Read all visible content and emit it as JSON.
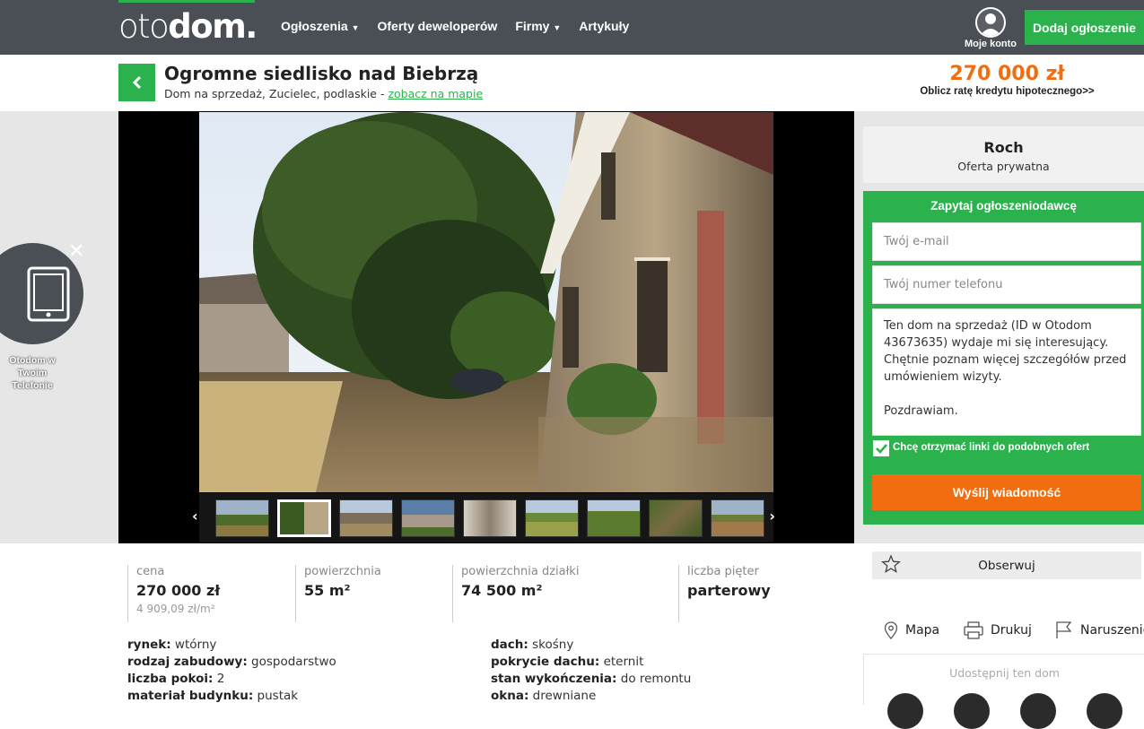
{
  "nav": {
    "logo_light": "oto",
    "logo_bold": "dom.",
    "menu": [
      {
        "label": "Ogłoszenia",
        "caret": true
      },
      {
        "label": "Oferty deweloperów",
        "caret": false
      },
      {
        "label": "Firmy",
        "caret": true
      },
      {
        "label": "Artykuły",
        "caret": false
      }
    ],
    "account_label": "Moje konto",
    "add_button": "Dodaj ogłoszenie"
  },
  "listing": {
    "title": "Ogromne siedlisko nad Biebrzą",
    "subtitle": "Dom na sprzedaż, Zucielec, podlaskie - ",
    "map_link": "zobacz na mapie",
    "price": "270 000 zł",
    "calc_link": "Oblicz ratę kredytu hipotecznego>>"
  },
  "gallery": {
    "thumb_count": 9,
    "active_thumb": 2
  },
  "promo": {
    "text": "Otodom w Twoim Telefonie",
    "close": "✕"
  },
  "seller": {
    "name": "Roch",
    "type": "Oferta prywatna"
  },
  "contact": {
    "title": "Zapytaj ogłoszeniodawcę",
    "email_placeholder": "Twój e-mail",
    "phone_placeholder": "Twój numer telefonu",
    "message": "Ten dom na sprzedaż (ID w Otodom 43673635) wydaje mi się interesujący. Chętnie poznam więcej szczegółów przed umówieniem wizyty.\n\nPozdrawiam.",
    "checkbox_label": "Chcę otrzymać linki do podobnych ofert",
    "checked": true,
    "send_button": "Wyślij wiadomość"
  },
  "stats": [
    {
      "label": "cena",
      "value": "270 000 zł",
      "sub": "4 909,09 zł/m²"
    },
    {
      "label": "powierzchnia",
      "value": "55 m²",
      "sub": ""
    },
    {
      "label": "powierzchnia działki",
      "value": "74 500 m²",
      "sub": ""
    },
    {
      "label": "liczba pięter",
      "value": "parterowy",
      "sub": ""
    }
  ],
  "details_left": [
    {
      "key": "rynek:",
      "value": "wtórny"
    },
    {
      "key": "rodzaj zabudowy:",
      "value": "gospodarstwo"
    },
    {
      "key": "liczba pokoi:",
      "value": "2"
    },
    {
      "key": "materiał budynku:",
      "value": "pustak"
    }
  ],
  "details_right": [
    {
      "key": "dach:",
      "value": "skośny"
    },
    {
      "key": "pokrycie dachu:",
      "value": "eternit"
    },
    {
      "key": "stan wykończenia:",
      "value": "do remontu"
    },
    {
      "key": "okna:",
      "value": "drewniane"
    }
  ],
  "sidebar": {
    "observe": "Obserwuj",
    "map": "Mapa",
    "print": "Drukuj",
    "report": "Naruszenie",
    "share_title": "Udostępnij ten dom"
  },
  "colors": {
    "brand_green": "#2bb24c",
    "price_orange": "#f26d0f",
    "nav_bg": "#4a4f55"
  }
}
